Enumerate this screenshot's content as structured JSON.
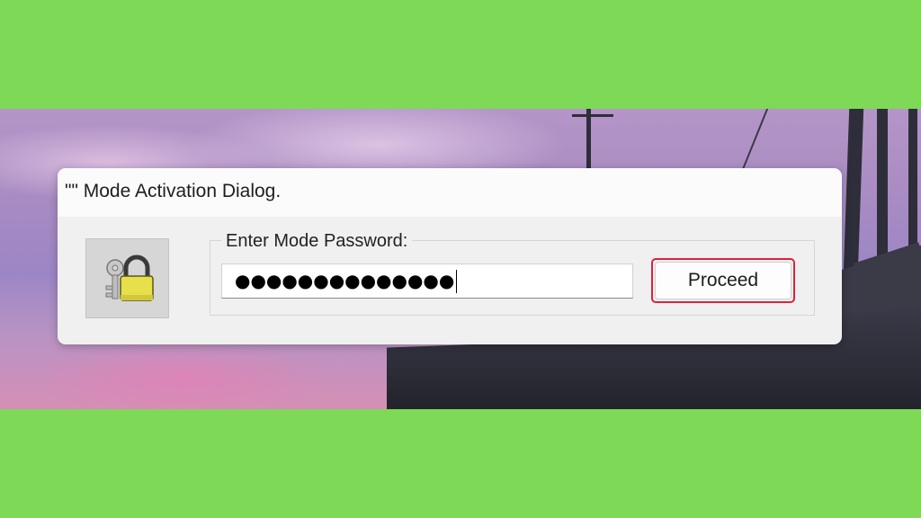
{
  "dialog": {
    "title": "\"\" Mode Activation Dialog.",
    "icon": "padlock-keys-icon",
    "group_label": "Enter Mode Password:",
    "password_value": "●●●●●●●●●●●●●●",
    "proceed_label": "Proceed"
  },
  "colors": {
    "frame": "#7ED957",
    "highlight": "#E0203A",
    "lock": "#E8E04A"
  }
}
